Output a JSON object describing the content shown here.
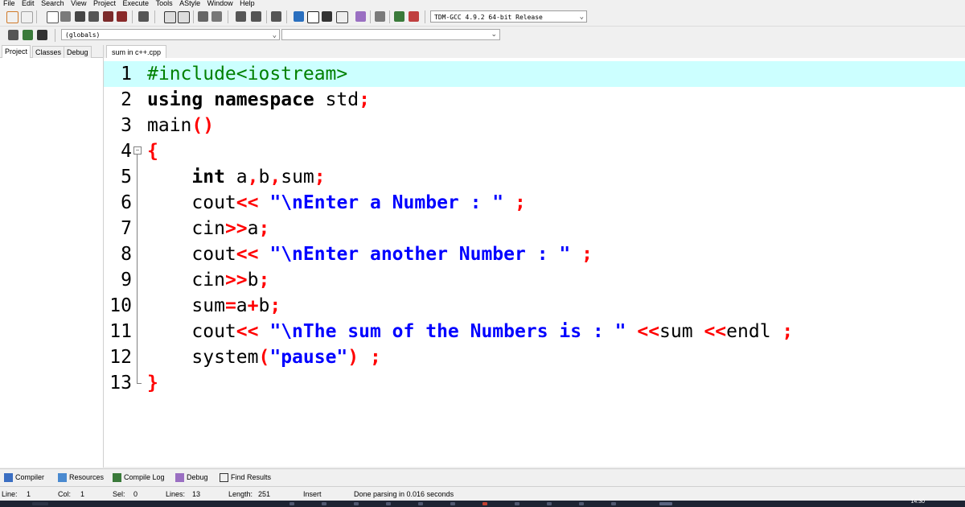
{
  "menu": [
    "File",
    "Edit",
    "Search",
    "View",
    "Project",
    "Execute",
    "Tools",
    "AStyle",
    "Window",
    "Help"
  ],
  "toolbar": {
    "compiler": "TDM-GCC 4.9.2 64-bit Release",
    "scope": "(globals)",
    "symbol": ""
  },
  "left_tabs": [
    "Project",
    "Classes",
    "Debug"
  ],
  "editor_tab": "sum in c++.cpp",
  "code_lines": [
    {
      "num": "1",
      "text": "#include<iostream>"
    },
    {
      "num": "2",
      "text": "using namespace std;"
    },
    {
      "num": "3",
      "text": "main()"
    },
    {
      "num": "4",
      "text": "{"
    },
    {
      "num": "5",
      "text": "    int a,b,sum;"
    },
    {
      "num": "6",
      "text": "    cout<< \"\\nEnter a Number : \" ;"
    },
    {
      "num": "7",
      "text": "    cin>>a;"
    },
    {
      "num": "8",
      "text": "    cout<< \"\\nEnter another Number : \" ;"
    },
    {
      "num": "9",
      "text": "    cin>>b;"
    },
    {
      "num": "10",
      "text": "    sum=a+b;"
    },
    {
      "num": "11",
      "text": "    cout<< \"\\nThe sum of the Numbers is : \" <<sum <<endl ;"
    },
    {
      "num": "12",
      "text": "    system(\"pause\") ;"
    },
    {
      "num": "13",
      "text": "}"
    }
  ],
  "bottom_tabs": [
    "Compiler",
    "Resources",
    "Compile Log",
    "Debug",
    "Find Results"
  ],
  "status": {
    "line_label": "Line:",
    "line_value": "1",
    "col_label": "Col:",
    "col_value": "1",
    "sel_label": "Sel:",
    "sel_value": "0",
    "lines_label": "Lines:",
    "lines_value": "13",
    "length_label": "Length:",
    "length_value": "251",
    "mode": "Insert",
    "message": "Done parsing in 0.016 seconds"
  },
  "taskbar": {
    "clock": "14:30"
  },
  "colors": {
    "highlight_line": "#ccffff",
    "keyword_symbol": "#ff0000",
    "string": "#0000ff",
    "preprocessor": "#008000"
  }
}
